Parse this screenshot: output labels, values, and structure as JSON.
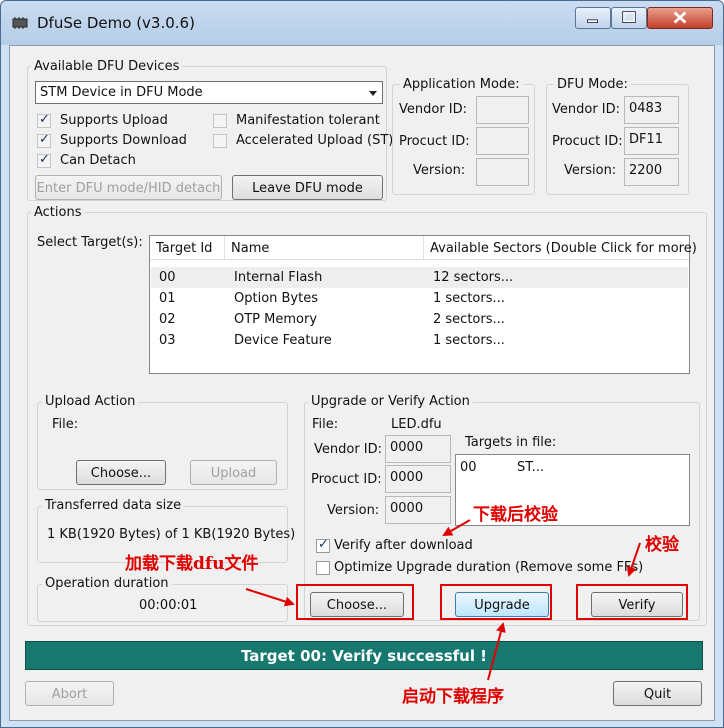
{
  "window": {
    "title": "DfuSe Demo (v3.0.6)"
  },
  "devices": {
    "group_label": "Available DFU Devices",
    "selected_device": "STM Device in DFU Mode",
    "supports_upload": "Supports Upload",
    "supports_download": "Supports Download",
    "can_detach": "Can Detach",
    "manifestation_tolerant": "Manifestation tolerant",
    "accelerated_upload": "Accelerated Upload (ST)",
    "enter_dfu_button": "Enter DFU mode/HID detach",
    "leave_dfu_button": "Leave DFU mode"
  },
  "app_mode": {
    "label": "Application Mode:",
    "vendor_label": "Vendor ID:",
    "product_label": "Procuct ID:",
    "version_label": "Version:",
    "vendor_value": "",
    "product_value": "",
    "version_value": ""
  },
  "dfu_mode": {
    "label": "DFU Mode:",
    "vendor_label": "Vendor ID:",
    "product_label": "Procuct ID:",
    "version_label": "Version:",
    "vendor_value": "0483",
    "product_value": "DF11",
    "version_value": "2200"
  },
  "actions": {
    "label": "Actions",
    "select_targets_label": "Select Target(s):",
    "columns": [
      "Target Id",
      "Name",
      "Available Sectors (Double Click for more)"
    ],
    "rows": [
      {
        "id": "00",
        "name": "Internal Flash",
        "sectors": "12 sectors..."
      },
      {
        "id": "01",
        "name": "Option Bytes",
        "sectors": "1 sectors..."
      },
      {
        "id": "02",
        "name": "OTP Memory",
        "sectors": "2 sectors..."
      },
      {
        "id": "03",
        "name": "Device Feature",
        "sectors": "1 sectors..."
      }
    ]
  },
  "upload": {
    "label": "Upload Action",
    "file_label": "File:",
    "choose_button": "Choose...",
    "upload_button": "Upload"
  },
  "transfer": {
    "label": "Transferred data size",
    "value": "1 KB(1920 Bytes) of 1 KB(1920 Bytes)"
  },
  "duration": {
    "label": "Operation duration",
    "value": "00:00:01"
  },
  "upgrade": {
    "label": "Upgrade or Verify Action",
    "file_label": "File:",
    "file_value": "LED.dfu",
    "vendor_label": "Vendor ID:",
    "product_label": "Procuct ID:",
    "version_label": "Version:",
    "vendor_value": "0000",
    "product_value": "0000",
    "version_value": "0000",
    "targets_label": "Targets in file:",
    "targets": [
      {
        "id": "00",
        "name": "ST..."
      }
    ],
    "verify_after_download": "Verify after download",
    "optimize": "Optimize Upgrade duration (Remove some FFs)",
    "choose_button": "Choose...",
    "upgrade_button": "Upgrade",
    "verify_button": "Verify"
  },
  "status": {
    "message": "Target 00: Verify successful !"
  },
  "bottom": {
    "abort_button": "Abort",
    "quit_button": "Quit"
  },
  "annotations": {
    "verify_after_download": "下载后校验",
    "verify": "校验",
    "load_file": "加载下载dfu文件",
    "start_download": "启动下载程序"
  },
  "colors": {
    "status_bar": "#16786f",
    "annotation": "#e00000"
  }
}
